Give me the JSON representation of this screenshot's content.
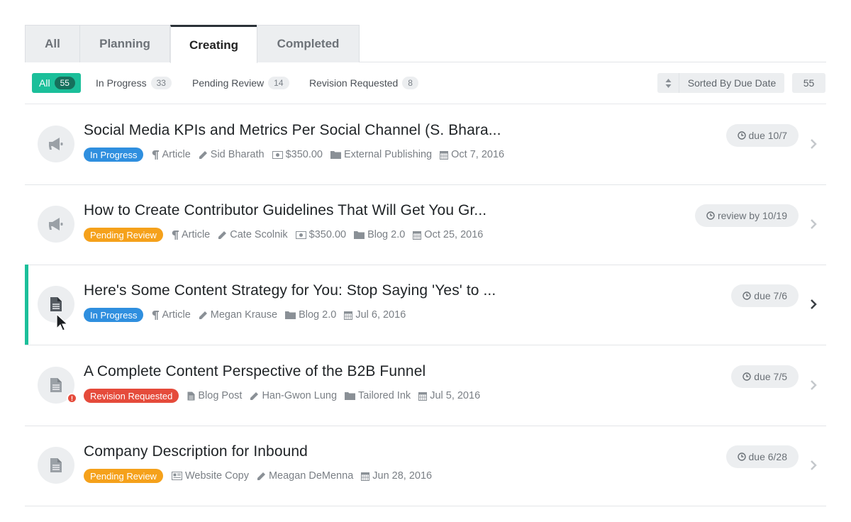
{
  "tabs": [
    "All",
    "Planning",
    "Creating",
    "Completed"
  ],
  "filters": {
    "all": {
      "label": "All",
      "count": "55"
    },
    "in_progress": {
      "label": "In Progress",
      "count": "33"
    },
    "pending_review": {
      "label": "Pending Review",
      "count": "14"
    },
    "revision_requested": {
      "label": "Revision Requested",
      "count": "8"
    }
  },
  "sort": {
    "label": "Sorted By Due Date",
    "icon": "sort-icon"
  },
  "total_count": "55",
  "colors": {
    "accent": "#1bbf9a",
    "in_progress": "#2f8fdf",
    "pending_review": "#f5a11b",
    "revision_requested": "#e54b3b"
  },
  "rows": [
    {
      "title": "Social Media KPIs and Metrics Per Social Channel (S. Bhara...",
      "status": "In Progress",
      "type": "Article",
      "author": "Sid Bharath",
      "price": "$350.00",
      "publication": "External Publishing",
      "date": "Oct 7, 2016",
      "due": "due 10/7",
      "icon": "megaphone-icon"
    },
    {
      "title": "How to Create Contributor Guidelines That Will Get You Gr...",
      "status": "Pending Review",
      "type": "Article",
      "author": "Cate Scolnik",
      "price": "$350.00",
      "publication": "Blog 2.0",
      "date": "Oct 25, 2016",
      "due": "review by 10/19",
      "icon": "megaphone-icon"
    },
    {
      "title": "Here's Some Content Strategy for You: Stop Saying 'Yes' to ...",
      "status": "In Progress",
      "type": "Article",
      "author": "Megan Krause",
      "publication": "Blog 2.0",
      "date": "Jul 6, 2016",
      "due": "due 7/6",
      "icon": "document-icon"
    },
    {
      "title": "A Complete Content Perspective of the B2B Funnel",
      "status": "Revision Requested",
      "type": "Blog Post",
      "author": "Han-Gwon Lung",
      "publication": "Tailored Ink",
      "date": "Jul 5, 2016",
      "due": "due 7/5",
      "icon": "document-icon",
      "alert": "!"
    },
    {
      "title": "Company Description for Inbound",
      "status": "Pending Review",
      "type": "Website Copy",
      "author": "Meagan DeMenna",
      "date": "Jun 28, 2016",
      "due": "due 6/28",
      "icon": "document-icon"
    }
  ]
}
